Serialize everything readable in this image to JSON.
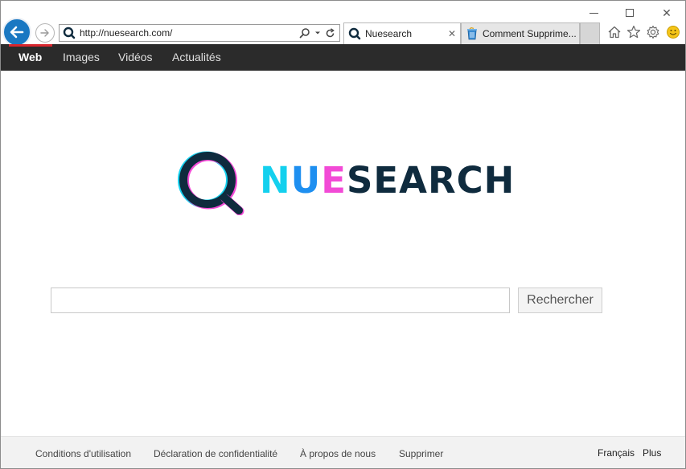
{
  "browser": {
    "address_url": "http://nuesearch.com/",
    "tabs": [
      {
        "title": "Nuesearch",
        "close_glyph": "✕",
        "favicon": "nuesearch-favicon-icon"
      },
      {
        "title": "Comment Supprime...",
        "favicon": "recycle-bin-favicon-icon"
      }
    ],
    "window_controls": {
      "close_glyph": "✕"
    },
    "toolbar_icons": [
      "home-icon",
      "star-icon",
      "gear-icon",
      "smiley-icon"
    ],
    "accent_color": "#1a78c2"
  },
  "nav": {
    "items": [
      {
        "label": "Web",
        "active": true
      },
      {
        "label": "Images",
        "active": false
      },
      {
        "label": "Vidéos",
        "active": false
      },
      {
        "label": "Actualités",
        "active": false
      }
    ],
    "indicator_color": "#d9262e",
    "background": "#2b2b2b"
  },
  "logo": {
    "parts": [
      "N",
      "U",
      "E",
      "SEARCH"
    ],
    "colors": [
      "#14d0ee",
      "#1e8ff0",
      "#f24ad6",
      "#0f2b3e"
    ]
  },
  "search": {
    "value": "",
    "placeholder": "",
    "button_label": "Rechercher"
  },
  "footer": {
    "links": [
      "Conditions d'utilisation",
      "Déclaration de confidentialité",
      "À propos de nous",
      "Supprimer"
    ],
    "language": "Français",
    "more": "Plus"
  }
}
